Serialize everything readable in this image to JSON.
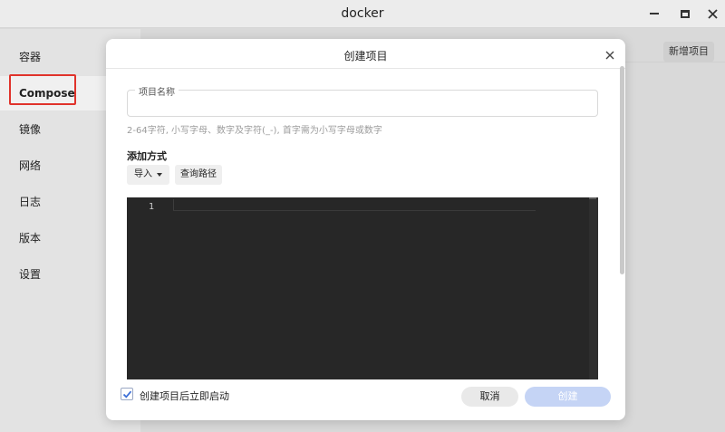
{
  "window": {
    "title": "docker"
  },
  "sidebar": {
    "items": [
      {
        "label": "容器"
      },
      {
        "label": "Compose"
      },
      {
        "label": "镜像"
      },
      {
        "label": "网络"
      },
      {
        "label": "日志"
      },
      {
        "label": "版本"
      },
      {
        "label": "设置"
      }
    ],
    "active_index": 1
  },
  "main": {
    "new_project_label": "新增项目"
  },
  "modal": {
    "title": "创建项目",
    "name_field": {
      "legend": "项目名称",
      "value": "",
      "hint": "2-64字符, 小写字母、数字及字符(_-), 首字需为小写字母或数字"
    },
    "add_method_label": "添加方式",
    "import_label": "导入",
    "query_path_label": "查询路径",
    "editor": {
      "line_number": "1",
      "content": ""
    },
    "start_after_create": {
      "label": "创建项目后立即启动",
      "checked": true
    },
    "cancel_label": "取消",
    "create_label": "创建"
  },
  "colors": {
    "highlight_border": "#e0332b",
    "primary_disabled": "#c5d4f5",
    "editor_bg": "#272727"
  }
}
